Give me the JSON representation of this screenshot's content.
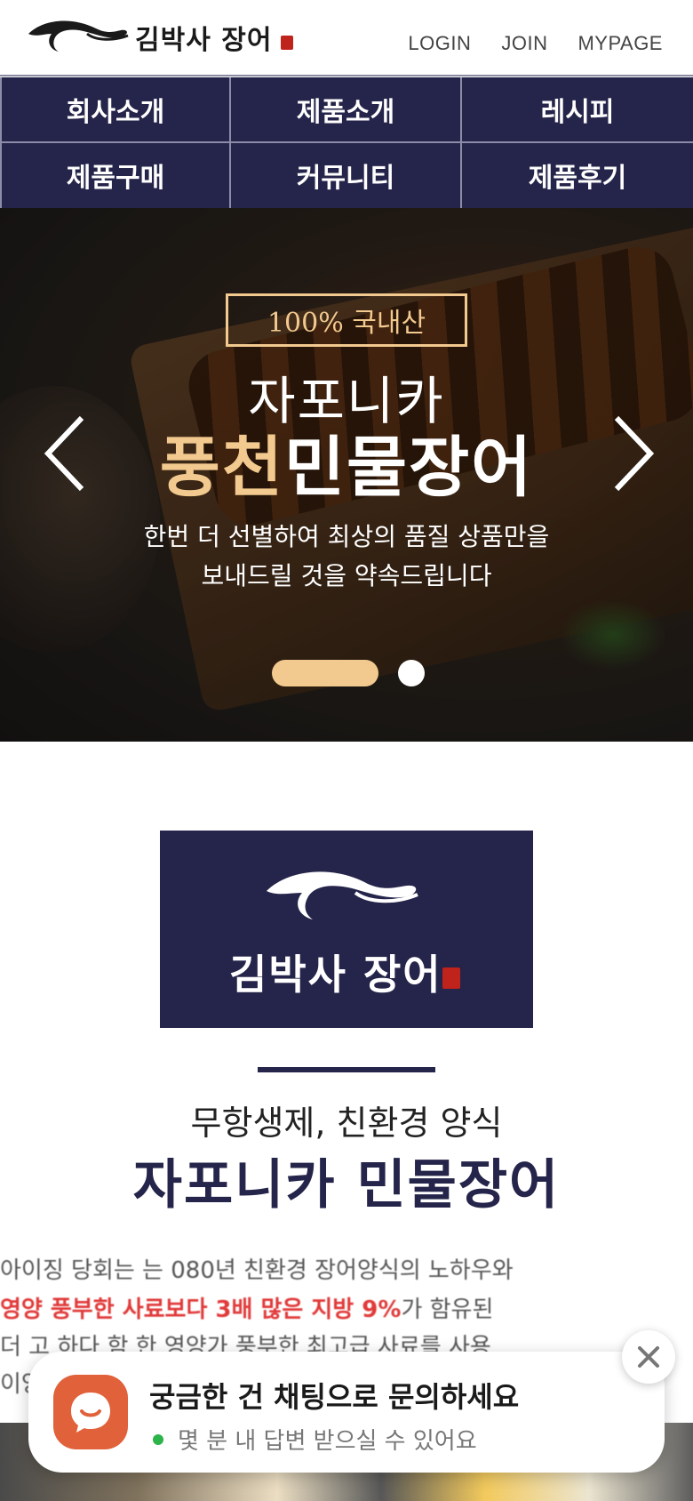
{
  "header": {
    "logo_text": "김박사 장어",
    "nav": [
      "LOGIN",
      "JOIN",
      "MYPAGE"
    ]
  },
  "main_nav": [
    "회사소개",
    "제품소개",
    "레시피",
    "제품구매",
    "커뮤니티",
    "제품후기"
  ],
  "hero": {
    "badge": "100% 국내산",
    "subtitle": "자포니카",
    "title_accent": "풍천",
    "title_rest": "민물장어",
    "desc_line1": "한번 더 선별하여 최상의 품질 상품만을",
    "desc_line2": "보내드릴 것을 약속드립니다",
    "slide_count": 2,
    "active_slide": 1
  },
  "brand": {
    "logo_text": "김박사 장어",
    "subtitle": "무항생제, 친환경 양식",
    "title": "자포니카 민물장어"
  },
  "body_text": {
    "line1": "아이징 당회는 는 080년 친환경 장어양식의 노하우와",
    "line2_red": "영양 풍부한 사료보다 3배 많은 지방 9%",
    "line2_rest": "가 함유된",
    "line3": "더 고 하다 함 한 영양가 풍부한 최고급 사료를 사용",
    "line4": "이양"
  },
  "chat": {
    "title": "궁금한 건 채팅으로 문의하세요",
    "status": "몇 분 내 답변 받으실 수 있어요"
  },
  "colors": {
    "navy": "#25244a",
    "gold": "#f2c98e",
    "chat_orange": "#e0613a",
    "status_green": "#2cb34a"
  },
  "icons": {
    "logo": "eel-logo-icon",
    "prev": "chevron-left-icon",
    "next": "chevron-right-icon",
    "chat": "chat-bubble-icon",
    "close": "close-icon"
  }
}
